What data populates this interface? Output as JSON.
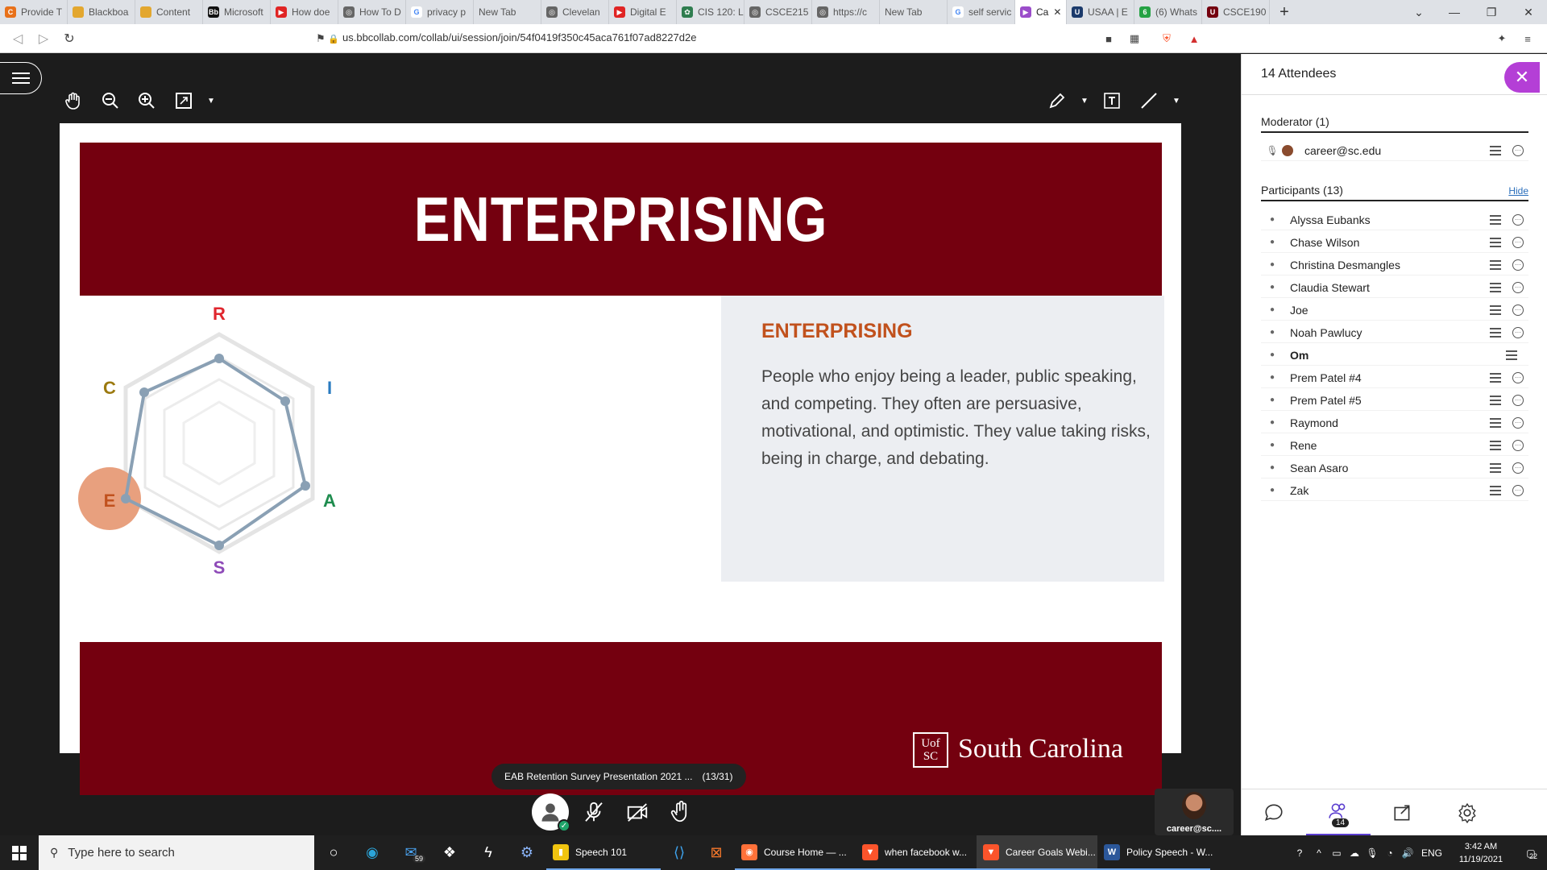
{
  "browser": {
    "tabs": [
      {
        "label": "Provide T",
        "fav_color": "#e8711a",
        "fav_text": "C"
      },
      {
        "label": "Blackboa",
        "fav_color": "#e3a72f",
        "fav_text": ""
      },
      {
        "label": "Content",
        "fav_color": "#e3a72f",
        "fav_text": ""
      },
      {
        "label": "Microsoft",
        "fav_color": "#111111",
        "fav_text": "Bb"
      },
      {
        "label": "How doe",
        "fav_color": "#e02424",
        "fav_text": "▶"
      },
      {
        "label": "How To D",
        "fav_color": "#666666",
        "fav_text": "◎"
      },
      {
        "label": "privacy p",
        "fav_color": "#ffffff",
        "fav_text": "G"
      },
      {
        "label": "New Tab",
        "fav_color": "",
        "fav_text": ""
      },
      {
        "label": "Clevelan",
        "fav_color": "#666666",
        "fav_text": "◎"
      },
      {
        "label": "Digital E",
        "fav_color": "#e02424",
        "fav_text": "▶"
      },
      {
        "label": "CIS 120: L",
        "fav_color": "#2f7d4f",
        "fav_text": "✿"
      },
      {
        "label": "CSCE215",
        "fav_color": "#666666",
        "fav_text": "◎"
      },
      {
        "label": "https://c",
        "fav_color": "#666666",
        "fav_text": "◎"
      },
      {
        "label": "New Tab",
        "fav_color": "",
        "fav_text": ""
      },
      {
        "label": "self servic",
        "fav_color": "#ffffff",
        "fav_text": "G"
      },
      {
        "label": "Ca",
        "fav_color": "#9b4dca",
        "fav_text": "▶",
        "active": true
      },
      {
        "label": "USAA | E",
        "fav_color": "#1b3a6b",
        "fav_text": "U"
      },
      {
        "label": "(6) Whats",
        "fav_color": "#25a244",
        "fav_text": "6"
      },
      {
        "label": "CSCE190",
        "fav_color": "#74000f",
        "fav_text": "U"
      }
    ],
    "url": "us.bbcollab.com/collab/ui/session/join/54f0419f350c45aca761f07ad8227d2e"
  },
  "slide": {
    "title": "ENTERPRISING",
    "heading": "ENTERPRISING",
    "body": "People who enjoy being a leader, public speaking, and competing. They often are persuasive, motivational, and optimistic. They value taking risks, being in charge, and debating.",
    "radar_labels": {
      "r": "R",
      "i": "I",
      "a": "A",
      "s": "S",
      "e": "E",
      "c": "C"
    },
    "radar_colors": {
      "r": "#e0262e",
      "i": "#2a7bc0",
      "a": "#1e8c4e",
      "s": "#8e4ab8",
      "e": "#c1511d",
      "c": "#9c7a10"
    },
    "logo_mark": "Uof SC",
    "logo_text": "South Carolina"
  },
  "presentation": {
    "name": "EAB Retention Survey Presentation 2021 ...",
    "page": "(13/31)"
  },
  "self_video": {
    "name": "career@sc...."
  },
  "attendees": {
    "title": "14 Attendees",
    "moderator_header": "Moderator (1)",
    "moderator": "career@sc.edu",
    "participants_header": "Participants (13)",
    "hide_label": "Hide",
    "participants": [
      "Alyssa Eubanks",
      "Chase Wilson",
      "Christina Desmangles",
      "Claudia Stewart",
      "Joe",
      "Noah Pawlucy",
      "Om",
      "Prem Patel #4",
      "Prem Patel #5",
      "Raymond",
      "Rene",
      "Sean Asaro",
      "Zak"
    ],
    "count_badge": "14"
  },
  "taskbar": {
    "search_placeholder": "Type here to search",
    "mail_badge": "59",
    "apps": [
      {
        "label": "Speech 101",
        "color": "#f1c40f",
        "icon": "▮"
      },
      {
        "label": "Course Home — ...",
        "color": "#ff7139",
        "icon": "◉"
      },
      {
        "label": "when facebook w...",
        "color": "#fb542b",
        "icon": "▼"
      },
      {
        "label": "Career Goals Webi...",
        "color": "#fb542b",
        "icon": "▼",
        "active": true
      },
      {
        "label": "Policy Speech - W...",
        "color": "#2b579a",
        "icon": "W"
      }
    ],
    "lang": "ENG",
    "time": "3:42 AM",
    "date": "11/19/2021",
    "notif_count": "22"
  }
}
